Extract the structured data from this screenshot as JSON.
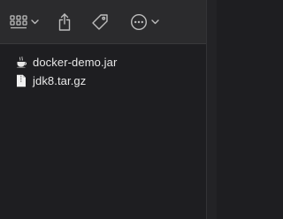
{
  "toolbar": {
    "view_icon": "grid-view-icon",
    "view_chevron_icon": "chevron-down-icon",
    "share_icon": "share-icon",
    "tag_icon": "tag-icon",
    "more_icon": "more-icon",
    "more_chevron_icon": "chevron-down-icon"
  },
  "files": [
    {
      "name": "docker-demo.jar",
      "icon": "java-jar-icon"
    },
    {
      "name": "jdk8.tar.gz",
      "icon": "archive-icon"
    }
  ],
  "colors": {
    "background": "#1e1e21",
    "toolbar": "#2b2b2d",
    "icon": "#bdbdbd",
    "text": "#e8e8e8"
  }
}
